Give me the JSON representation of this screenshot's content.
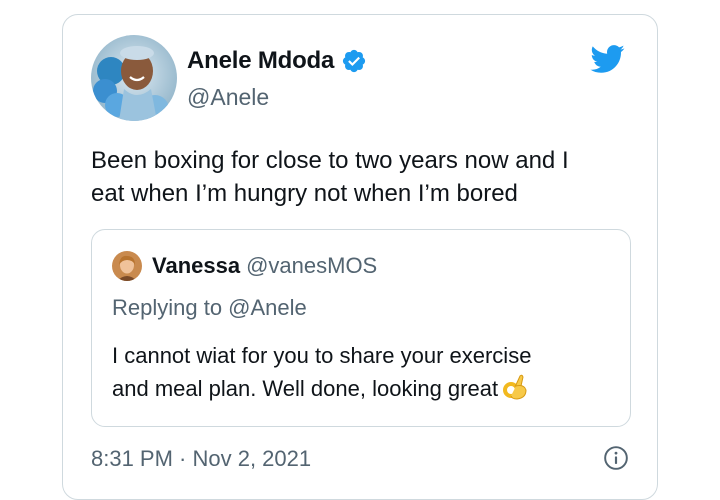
{
  "tweet": {
    "author": {
      "name": "Anele Mdoda",
      "handle": "@Anele",
      "verified_icon": "verified-badge-icon"
    },
    "text": "Been boxing for close to two years now and I\neat when I’m hungry not when I’m bored",
    "timestamp": "8:31 PM · Nov 2, 2021",
    "brand_icon": "twitter-bird-icon",
    "info_icon": "info-icon"
  },
  "quoted": {
    "author_name": "Vanessa",
    "author_handle": "@vanesMOS",
    "replying_to": "Replying to @Anele",
    "text": "I cannot wiat for you to share your exercise\nand meal plan. Well done, looking great",
    "emoji_icon": "ok-hand-emoji-icon"
  },
  "colors": {
    "accent": "#1d9bf0",
    "text": "#0f1419",
    "secondary": "#536471",
    "border": "#cfd9de"
  }
}
